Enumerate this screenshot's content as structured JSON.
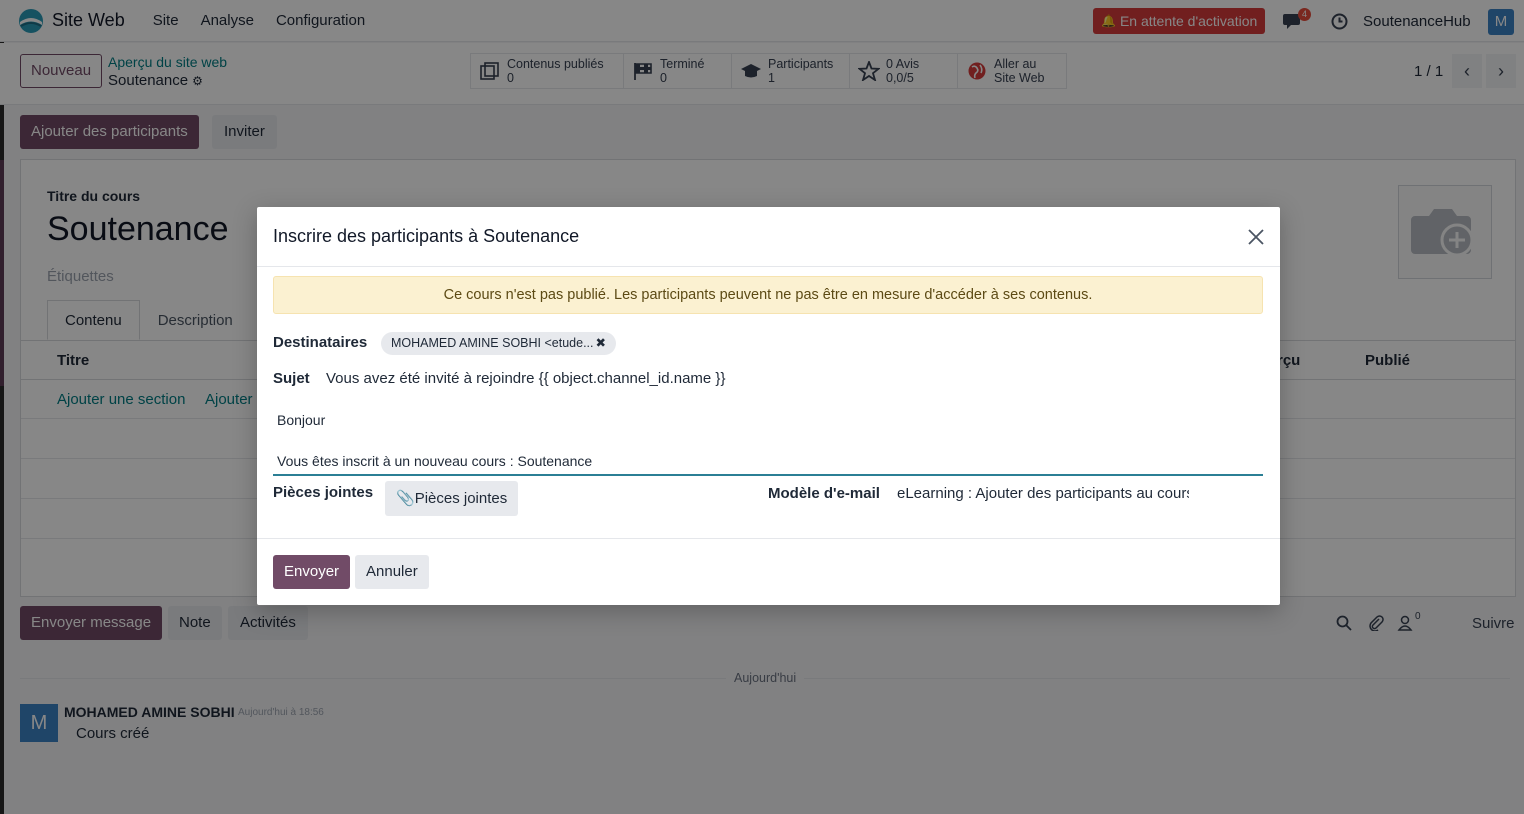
{
  "topnav": {
    "app_name": "Site Web",
    "menu": [
      "Site",
      "Analyse",
      "Configuration"
    ],
    "activation_label": "En attente d'activation",
    "chat_badge": "4",
    "company": "SoutenanceHub",
    "user_initial": "M"
  },
  "controlbar": {
    "new_label": "Nouveau",
    "breadcrumb_link": "Aperçu du site web",
    "breadcrumb_current": "Soutenance",
    "smart_buttons": [
      {
        "line1": "Contenus publiés",
        "line2": "0",
        "icon": "content-icon"
      },
      {
        "line1": "Terminé",
        "line2": "0",
        "icon": "flag-icon"
      },
      {
        "line1": "Participants",
        "line2": "1",
        "icon": "graduation-cap-icon"
      },
      {
        "line1": "0 Avis",
        "line2": "0,0/5",
        "icon": "star-icon"
      },
      {
        "line1": "Aller au",
        "line2": "Site Web",
        "icon": "globe-icon"
      }
    ],
    "pager": "1 / 1"
  },
  "actions": {
    "add_participants": "Ajouter des participants",
    "invite": "Inviter"
  },
  "form": {
    "title_label": "Titre du cours",
    "title": "Soutenance",
    "tags_placeholder": "Étiquettes",
    "tabs": [
      "Contenu",
      "Description"
    ],
    "columns": {
      "title": "Titre",
      "preview": "rçu",
      "published": "Publié"
    },
    "add_section": "Ajouter une section",
    "add_content": "Ajouter"
  },
  "chatter": {
    "send_message": "Envoyer message",
    "note": "Note",
    "activities": "Activités",
    "follower_count": "0",
    "follow": "Suivre",
    "date_separator": "Aujourd'hui",
    "message": {
      "author": "MOHAMED AMINE SOBHI",
      "time": "Aujourd'hui à 18:56",
      "body": "Cours créé",
      "initial": "M"
    }
  },
  "modal": {
    "title": "Inscrire des participants à Soutenance",
    "alert": "Ce cours n'est pas publié. Les participants peuvent ne pas être en mesure d'accéder à ses contenus.",
    "recipients_label": "Destinataires",
    "recipient_tag": "MOHAMED AMINE SOBHI <etude...",
    "subject_label": "Sujet",
    "subject_value": "Vous avez été invité à rejoindre {{ object.channel_id.name }}",
    "body_greeting": "Bonjour",
    "body_line": "Vous êtes inscrit à un nouveau cours : Soutenance",
    "attachments_label": "Pièces jointes",
    "attachments_button": "Pièces jointes",
    "template_label": "Modèle d'e-mail",
    "template_value": "eLearning : Ajouter des participants au cours",
    "send": "Envoyer",
    "cancel": "Annuler"
  },
  "colors": {
    "primary": "#714b67",
    "link": "#017e84",
    "danger": "#d63b3b",
    "alert_bg": "#fbf1d1",
    "avatar": "#3b82c4"
  }
}
